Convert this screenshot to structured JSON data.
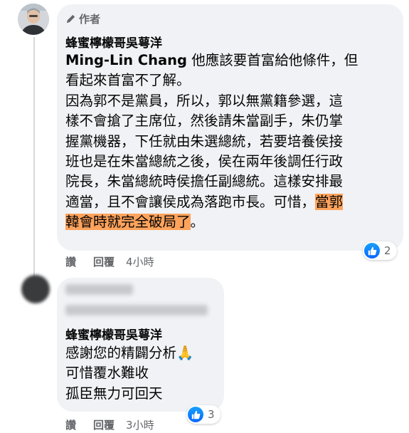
{
  "comment_1": {
    "author_badge": "作者",
    "author": "蜂蜜檸檬哥吳萼洋",
    "mention": "Ming-Lin Chang",
    "lines": [
      " 他應該要首富給他條件，但",
      "看起來首富不了解。",
      "因為郭不是黨員，所以，郭以無黨籍參選，這",
      "樣不會搶了主席位，然後請朱當副手，朱仍掌",
      "握黨機器，下任就由朱選總統，若要培養侯接",
      "班也是在朱當總統之後，侯在兩年後調任行政",
      "院長，朱當總統時侯擔任副總統。這樣安排最",
      "適當，且不會讓侯成為落跑市長。可惜，"
    ],
    "highlight_1": "當郭",
    "highlight_2": "韓會時就完全破局了",
    "last_suffix": "。",
    "actions": {
      "like": "讚",
      "reply": "回覆",
      "time": "4小時"
    },
    "reactions": {
      "icon": "like-icon",
      "count": "2"
    }
  },
  "comment_2": {
    "author": "蜂蜜檸檬哥吳萼洋",
    "lines": [
      "感謝您的精闢分析🙏",
      "可惜覆水難收",
      "孤臣無力可回天"
    ],
    "actions": {
      "like": "讚",
      "reply": "回覆",
      "time": "3小時"
    },
    "reactions": {
      "icon": "like-icon",
      "count": "3"
    }
  },
  "colors": {
    "bubble": "#f0f2f5",
    "highlight": "#ffa35c",
    "like_blue": "#0866ff",
    "secondary_text": "#65676b"
  }
}
